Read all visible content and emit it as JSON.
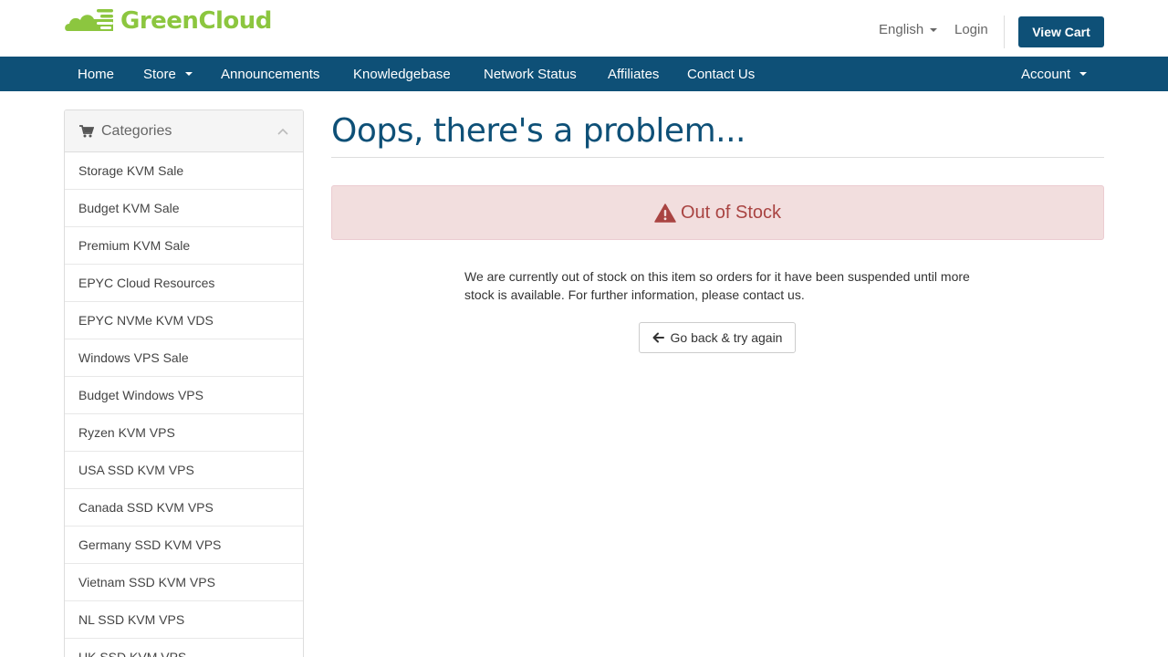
{
  "header": {
    "brand": "GreenCloud",
    "language": "English",
    "login": "Login",
    "view_cart": "View Cart"
  },
  "nav": {
    "items": [
      "Home",
      "Store",
      "Announcements",
      "Knowledgebase",
      "Network Status",
      "Affiliates",
      "Contact Us"
    ],
    "account": "Account"
  },
  "sidebar": {
    "title": "Categories",
    "items": [
      "Storage KVM Sale",
      "Budget KVM Sale",
      "Premium KVM Sale",
      "EPYC Cloud Resources",
      "EPYC NVMe KVM VDS",
      "Windows VPS Sale",
      "Budget Windows VPS",
      "Ryzen KVM VPS",
      "USA SSD KVM VPS",
      "Canada SSD KVM VPS",
      "Germany SSD KVM VPS",
      "Vietnam SSD KVM VPS",
      "NL SSD KVM VPS",
      "UK SSD KVM VPS"
    ]
  },
  "main": {
    "title": "Oops, there's a problem...",
    "alert": "Out of Stock",
    "message": "We are currently out of stock on this item so orders for it have been suspended until more stock is available. For further information, please contact us.",
    "back_button": "Go back & try again"
  },
  "colors": {
    "brand_green": "#8cc63f",
    "nav_blue": "#0e5077",
    "alert_bg": "#f2dede",
    "alert_text": "#a94442"
  },
  "icons": {
    "logo": "cloud-logo-icon",
    "cart": "cart-icon",
    "collapse": "chevron-up-icon",
    "alert": "warning-icon",
    "back": "arrow-left-icon"
  }
}
